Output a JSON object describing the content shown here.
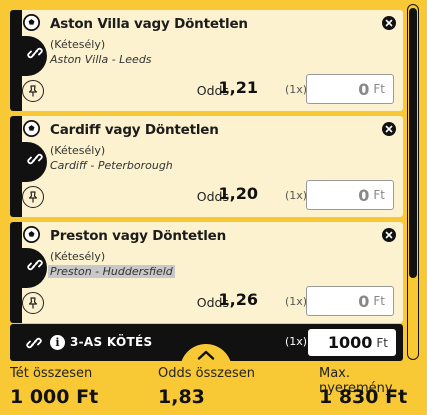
{
  "bets": [
    {
      "title": "Aston Villa vagy Döntetlen",
      "type": "(Kétesély)",
      "match": "Aston Villa - Leeds",
      "odds_label": "Odds",
      "odds": "1,21",
      "multiplier": "(1x)",
      "stake": "0",
      "currency": "Ft"
    },
    {
      "title": "Cardiff vagy Döntetlen",
      "type": "(Kétesély)",
      "match": "Cardiff - Peterborough",
      "odds_label": "Odds",
      "odds": "1,20",
      "multiplier": "(1x)",
      "stake": "0",
      "currency": "Ft"
    },
    {
      "title": "Preston vagy Döntetlen",
      "type": "(Kétesély)",
      "match": "Preston - Huddersfield",
      "odds_label": "Odds",
      "odds": "1,26",
      "multiplier": "(1x)",
      "stake": "0",
      "currency": "Ft"
    }
  ],
  "combo": {
    "label": "3-AS KÖTÉS",
    "info_glyph": "i",
    "multiplier": "(1x)",
    "stake": "1000",
    "currency": "Ft"
  },
  "summary": {
    "stake_label": "Tét összesen",
    "stake_value": "1 000 Ft",
    "odds_label": "Odds összesen",
    "odds_value": "1,83",
    "max_label": "Max. nyeremény",
    "max_value": "1 830 Ft"
  },
  "colors": {
    "background": "#f9c935",
    "card": "#fdf2cf",
    "dark": "#111111"
  },
  "icons": {
    "ball": "soccer-ball-icon",
    "link": "link-icon",
    "pin": "pin-icon",
    "close": "close-icon",
    "info": "info-icon",
    "expand": "chevron-up-icon"
  }
}
